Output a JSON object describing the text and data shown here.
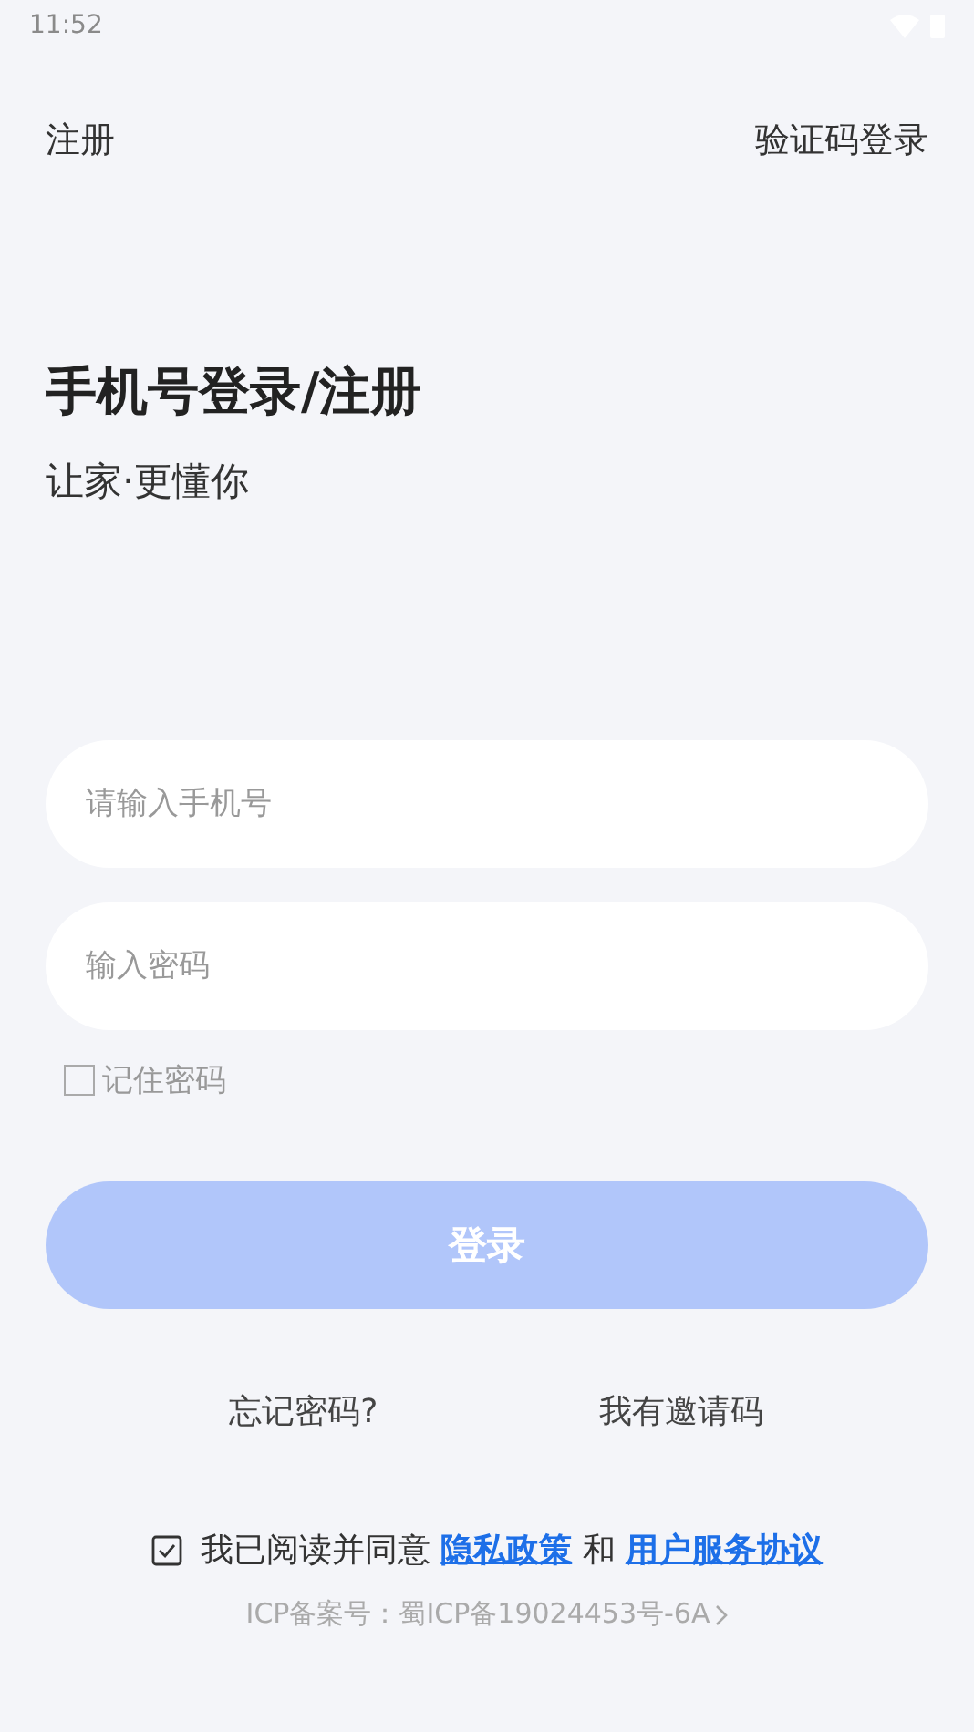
{
  "status_bar": {
    "time": "11:52"
  },
  "nav": {
    "left": "注册",
    "right": "验证码登录"
  },
  "heading": {
    "title": "手机号登录/注册",
    "subtitle": "让家·更懂你"
  },
  "fields": [
    {
      "placeholder": "请输入手机号"
    },
    {
      "placeholder": "输入密码"
    }
  ],
  "remember": {
    "label": "记住密码",
    "checked": false
  },
  "login_button": {
    "label": "登录",
    "disabled": true
  },
  "links": [
    "忘记密码?",
    "我有邀请码"
  ],
  "agreement": {
    "checked": true,
    "before": "我已阅读并同意",
    "link_1": "隐私政策",
    "middle": "和",
    "link_2": "用户服务协议"
  },
  "icp": "ICP备案号：蜀ICP备19024453号-6A"
}
